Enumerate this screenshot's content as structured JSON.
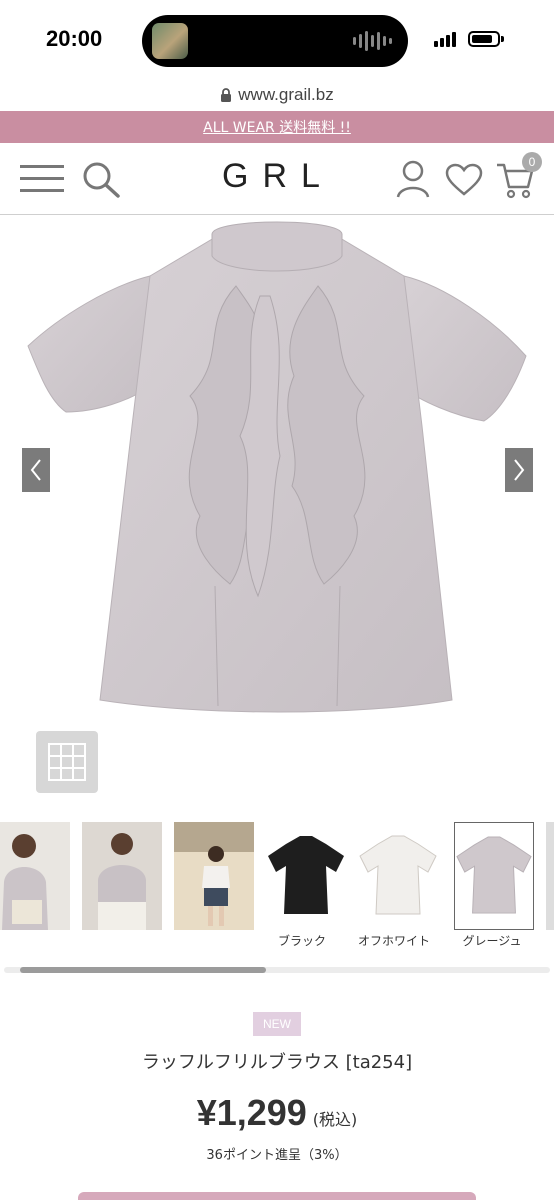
{
  "status_bar": {
    "time": "20:00"
  },
  "browser": {
    "url": "www.grail.bz"
  },
  "banner": {
    "text": "ALL WEAR 送料無料 !!"
  },
  "header": {
    "logo": "GRL",
    "cart_count": "0",
    "icons": [
      "menu-icon",
      "search-icon",
      "account-icon",
      "favorite-heart-icon",
      "cart-icon"
    ]
  },
  "gallery": {
    "prev_icon": "chevron-left-icon",
    "next_icon": "chevron-right-icon",
    "grid_icon": "grid-icon"
  },
  "thumbnails": [
    {
      "label": ""
    },
    {
      "label": ""
    },
    {
      "label": ""
    },
    {
      "label": "ブラック"
    },
    {
      "label": "オフホワイト"
    },
    {
      "label": "グレージュ"
    }
  ],
  "product": {
    "badge": "NEW",
    "name": "ラッフルフリルブラウス [ta254]",
    "price": "¥1,299",
    "tax_note": "(税込)",
    "points": "36ポイント進呈（3%）"
  },
  "colors": {
    "banner": "#c98ea1",
    "badge": "#e2cfe0",
    "blouse_greige": "#cfc8cc"
  }
}
